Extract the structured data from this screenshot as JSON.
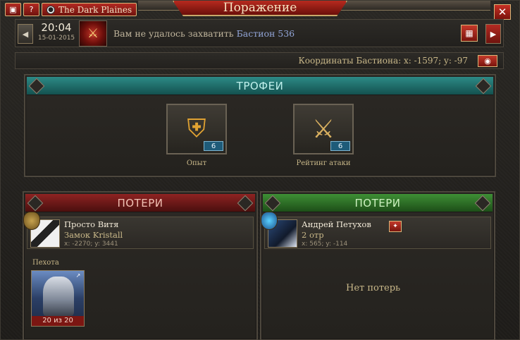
{
  "window": {
    "title": "Поражение",
    "server_name": "The Dark Plaines"
  },
  "topbar": {
    "camera_icon": "camera-icon",
    "help_label": "?",
    "close_label": "✕"
  },
  "message": {
    "time": "20:04",
    "date": "15-01-2015",
    "text_prefix": "Вам не удалось захватить",
    "target": "Бастион 536"
  },
  "coords": {
    "text": "Координаты Бастиона: x: -1597; y: -97"
  },
  "trophies": {
    "header": "ТРОФЕИ",
    "items": [
      {
        "label": "Опыт",
        "count": "6",
        "icon": "experience-shield-icon"
      },
      {
        "label": "Рейтинг атаки",
        "count": "6",
        "icon": "crossed-swords-icon"
      }
    ]
  },
  "losses_left": {
    "header": "ПОТЕРИ",
    "player": {
      "name": "Просто Витя",
      "castle": "Замок Kristall",
      "coords": "x: -2270; y: 3441"
    },
    "unit_type_label": "Пехота",
    "unit_count": "20 из 20"
  },
  "losses_right": {
    "header": "ПОТЕРИ",
    "player": {
      "name": "Андрей Петухов",
      "detail": "2 отр",
      "coords": "x: 565; y: -114"
    },
    "no_losses": "Нет потерь"
  },
  "colors": {
    "accent_red": "#b32a22",
    "teal_header": "#2d8a86",
    "green_header": "#3e8f35",
    "red_header": "#8e2322",
    "gold_text": "#c9b889",
    "target_link": "#93a6d9"
  }
}
